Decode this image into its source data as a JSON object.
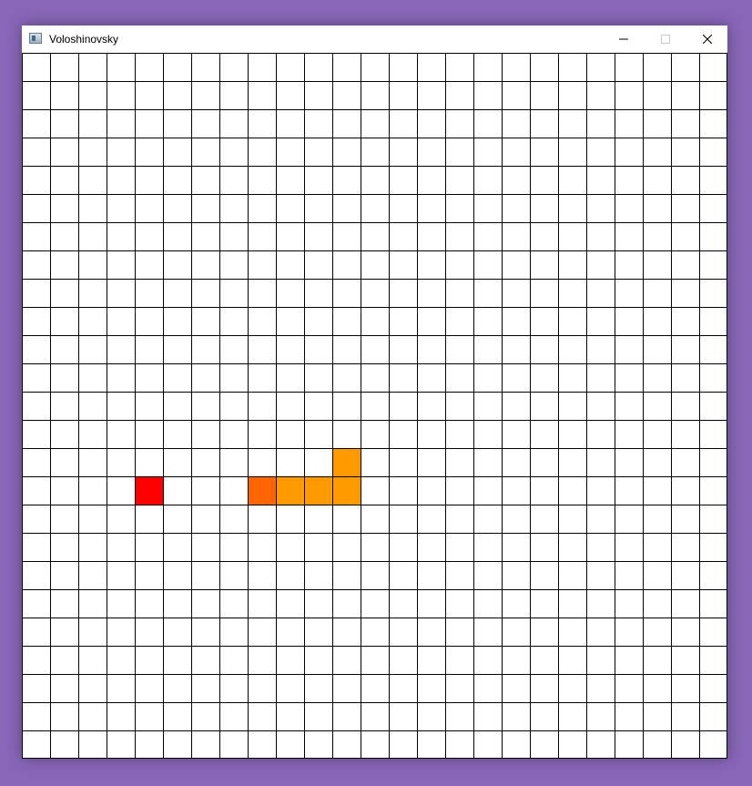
{
  "window": {
    "title": "Voloshinovsky",
    "icon": "app-window-icon",
    "controls": [
      "minimize-icon",
      "maximize-icon",
      "close-icon"
    ]
  },
  "board": {
    "columns": 25,
    "rows": 25,
    "grid_color": "#000000",
    "background": "#ffffff",
    "food": {
      "col": 4,
      "row": 15,
      "color": "#ff0000"
    },
    "snake": {
      "head_color": "#ff6600",
      "body_color": "#ff9900",
      "segments": [
        {
          "col": 8,
          "row": 15
        },
        {
          "col": 9,
          "row": 15
        },
        {
          "col": 10,
          "row": 15
        },
        {
          "col": 11,
          "row": 15
        },
        {
          "col": 11,
          "row": 14
        }
      ]
    }
  }
}
